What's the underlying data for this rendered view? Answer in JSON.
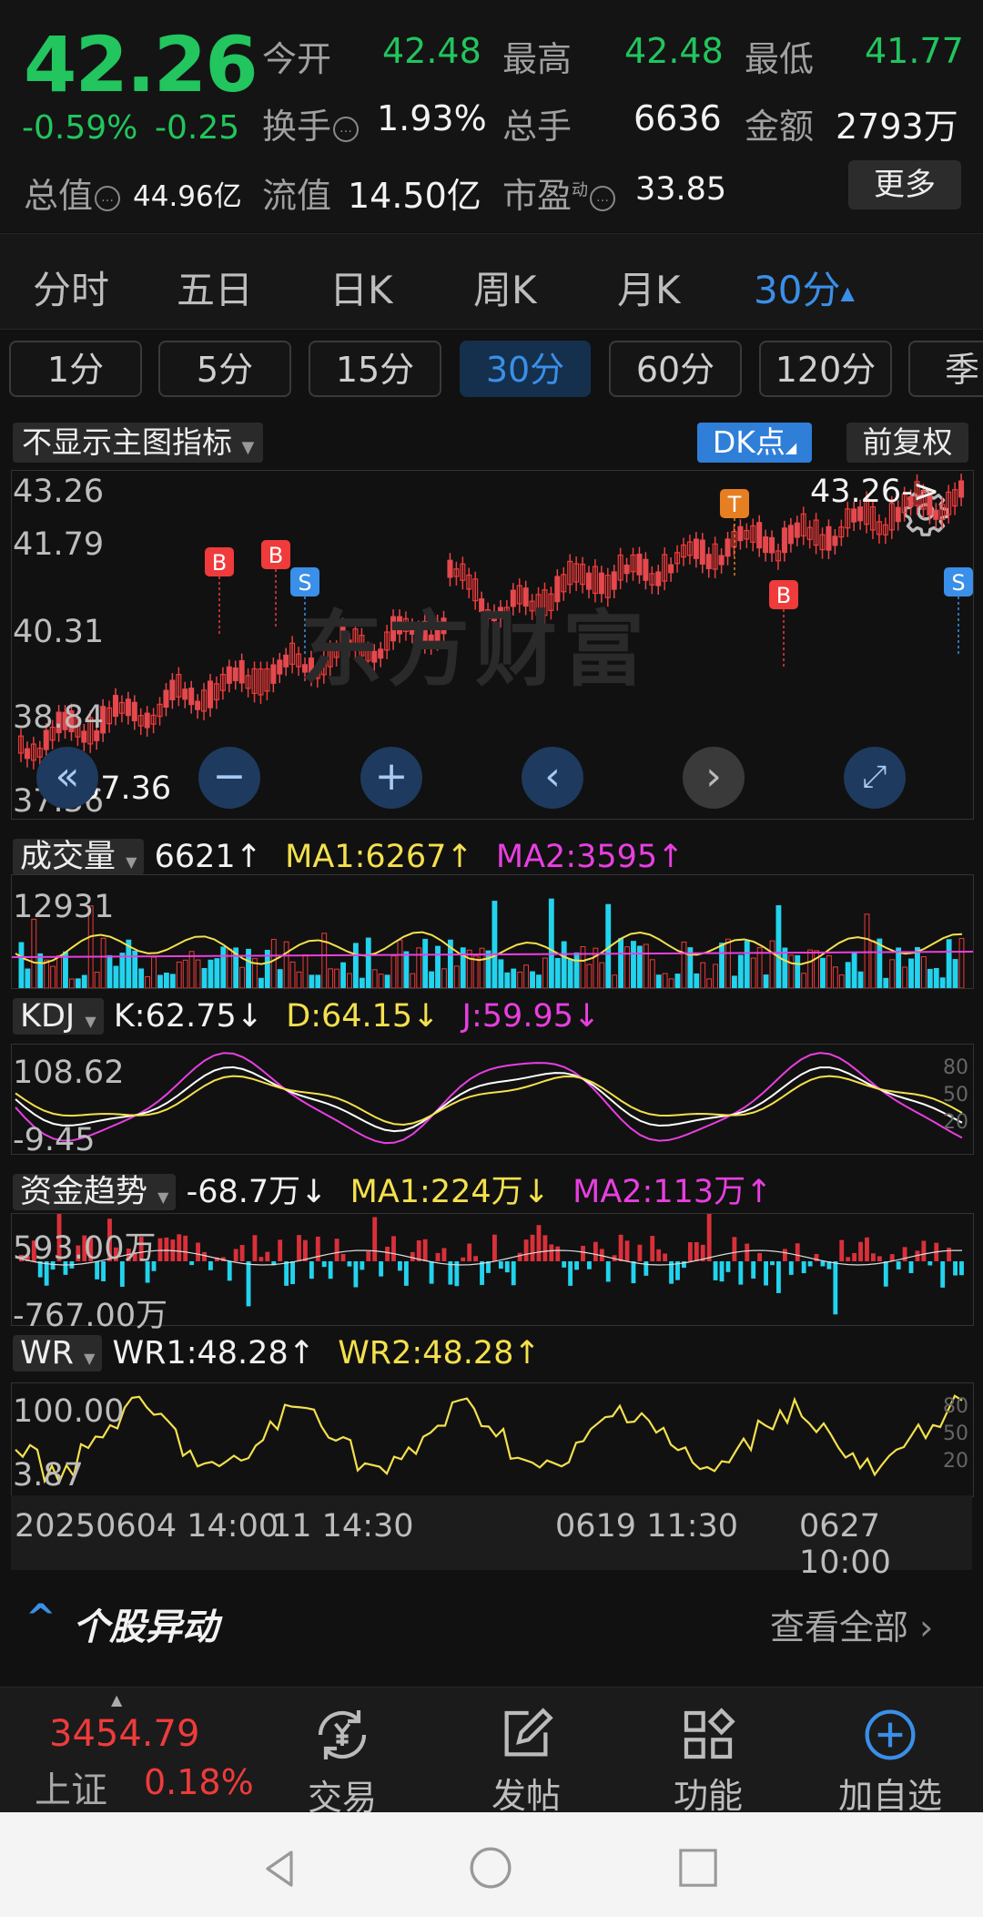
{
  "quote": {
    "price": "42.26",
    "change_pct": "-0.59%",
    "change": "-0.25",
    "open_label": "今开",
    "open": "42.48",
    "high_label": "最高",
    "high": "42.48",
    "low_label": "最低",
    "low": "41.77",
    "turnover_label": "换手",
    "turnover": "1.93%",
    "volume_label": "总手",
    "volume": "6636",
    "amount_label": "金额",
    "amount": "2793万",
    "mktcap_label": "总值",
    "mktcap": "44.96亿",
    "float_label": "流值",
    "float": "14.50亿",
    "pe_label": "市盈",
    "pe_sup": "动",
    "pe": "33.85",
    "more": "更多"
  },
  "tabs": [
    "分时",
    "五日",
    "日K",
    "周K",
    "月K",
    "30分"
  ],
  "active_tab": "30分",
  "minute_buttons": [
    "1分",
    "5分",
    "15分",
    "30分",
    "60分",
    "120分",
    "季"
  ],
  "chart": {
    "indicator_select": "不显示主图指标",
    "dk_button": "DK点",
    "fq_button": "前复权",
    "watermark": "东方财富",
    "y_ticks": [
      "43.26",
      "41.79",
      "40.31",
      "38.84",
      "37.36"
    ],
    "max_label": "43.26->",
    "min_label": "<-37.36",
    "signals": [
      "B",
      "B",
      "S",
      "T",
      "B",
      "S"
    ]
  },
  "volume": {
    "select": "成交量",
    "value": "6621↑",
    "ma1": "MA1:6267↑",
    "ma2": "MA2:3595↑",
    "top": "12931"
  },
  "kdj": {
    "select": "KDJ",
    "k": "K:62.75↓",
    "d": "D:64.15↓",
    "j": "J:59.95↓",
    "top": "108.62",
    "bottom": "-9.45",
    "levels": [
      "80",
      "50",
      "20"
    ]
  },
  "fund": {
    "select": "资金趋势",
    "value": "-68.7万↓",
    "ma1": "MA1:224万↓",
    "ma2": "MA2:113万↑",
    "top": "593.00万",
    "bottom": "-767.00万"
  },
  "wr": {
    "select": "WR",
    "wr1": "WR1:48.28↑",
    "wr2": "WR2:48.28↑",
    "top": "100.00",
    "bottom": "3.87",
    "levels": [
      "80",
      "50",
      "20"
    ]
  },
  "time_axis": {
    "t1": "20250604 14:00",
    "t2": "11 14:30",
    "t3": "0619 11:30",
    "t4": "0627 10:00"
  },
  "yidong": {
    "title": "个股异动",
    "view_all": "查看全部"
  },
  "bottom_bar": {
    "index_value": "3454.79",
    "index_name": "上证",
    "index_change": "0.18%",
    "trade": "交易",
    "post": "发帖",
    "function": "功能",
    "add": "加自选"
  }
}
